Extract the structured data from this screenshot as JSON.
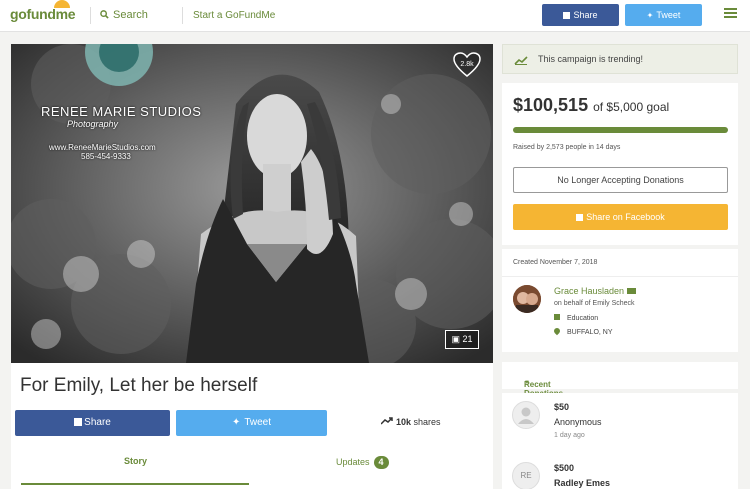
{
  "header": {
    "logo": "gofundme",
    "search_label": "Search",
    "start_label": "Start a GoFundMe",
    "share_facebook_label": "Share",
    "share_twitter_label": "Tweet"
  },
  "campaign": {
    "title": "For Emily, Let her be herself",
    "favorites_count": "2.8k",
    "photo_count": "21",
    "photo_watermark": {
      "line1": "RENEE MARIE STUDIOS",
      "line2": "Photography",
      "line3": "www.ReneeMarieStudios.com",
      "line4": "585-454-9333"
    },
    "share_facebook_label": "Share",
    "tweet_label": "Tweet",
    "shares_count": "10k",
    "shares_label": "shares",
    "tabs": [
      {
        "label": "Story",
        "active": true
      },
      {
        "label": "Updates",
        "count": "4",
        "active": false
      }
    ]
  },
  "sidebar": {
    "trending_text": "This campaign is trending!",
    "raised_amount": "$100,515",
    "goal_text": "of $5,000 goal",
    "progress_fraction": 1.0,
    "raised_by_text": "Raised by 2,573 people in 14 days",
    "no_donations_label": "No Longer Accepting Donations",
    "share_facebook_label": "Share on Facebook",
    "created_text": "Created November 7, 2018",
    "organizer": {
      "name": "Grace Hausladen",
      "on_behalf": "on behalf of Emily Scheck",
      "category": "Education",
      "location": "BUFFALO, NY"
    },
    "recent_donations_label": "Recent Donations",
    "donations": [
      {
        "amount": "$50",
        "name": "Anonymous",
        "time": "1 day ago",
        "initials": ""
      },
      {
        "amount": "$500",
        "name": "Radley Emes",
        "time": "",
        "initials": "RE"
      }
    ]
  },
  "colors": {
    "brand_green": "#6a8b3a",
    "facebook_blue": "#3b5998",
    "twitter_blue": "#55acee",
    "share_orange": "#f5b533"
  }
}
